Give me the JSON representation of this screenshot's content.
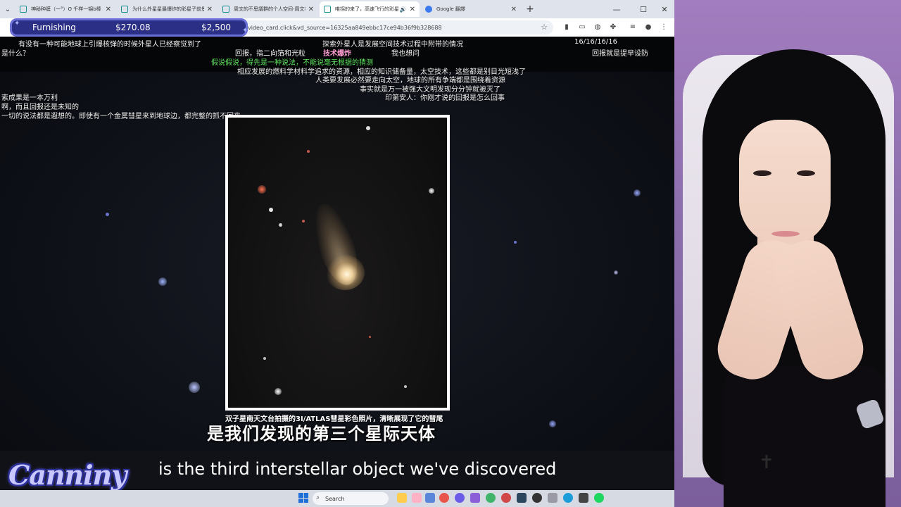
{
  "tabs": [
    {
      "label": "神秘种膜（一°）O 千样一锦b棒",
      "icon": "tab-page-icon",
      "active": false
    },
    {
      "label": "为什么外星星最爆炸的彩星子前景号",
      "icon": "tab-page-icon",
      "active": false
    },
    {
      "label": "周文的不思議群的个人空间-周文初",
      "icon": "tab-page-icon",
      "active": false
    },
    {
      "label": "唯拐的来了，高速飞行的彩星…",
      "icon": "tab-page-icon",
      "active": true
    },
    {
      "label": "Google 翻譯",
      "icon": "google-translate-icon",
      "active": false
    }
  ],
  "address": {
    "url": "video_card.click&vd_source=16325aa849ebbc17ce94b36f9b328688"
  },
  "furnishing": {
    "label": "Furnishing",
    "value": "$270.08",
    "target": "$2,500"
  },
  "danmaku": [
    {
      "text": "有没有一种可能地球上引爆核弹的时候外星人已经察觉到了",
      "color": "white"
    },
    {
      "text": "是什么？",
      "color": "white"
    },
    {
      "text": "探索外星人是发展空间技术过程中附带的情况",
      "color": "white"
    },
    {
      "text": "16/16/16/16",
      "color": "white"
    },
    {
      "text": "回报，指二向箔和光粒",
      "color": "white"
    },
    {
      "text": "技术爆炸",
      "color": "pink"
    },
    {
      "text": "我也想问",
      "color": "white"
    },
    {
      "text": "回报就是提早设防",
      "color": "white"
    },
    {
      "text": "假说假说，得先是一种说法，不能说毫无根据的猜测",
      "color": "green"
    },
    {
      "text": "相应发展的燃料学材料学追求的资源，相应的知识储备量，太空技术，这些都是别目光短浅了",
      "color": "white"
    },
    {
      "text": "人类要发展必然要走向太空，地球的所有争端都是围绕着资源",
      "color": "white"
    },
    {
      "text": "事实就是万一被强大文明发现分分钟就被灭了",
      "color": "white"
    },
    {
      "text": "印第安人：你刚才说的回报是怎么回事",
      "color": "white"
    },
    {
      "text": "索成果是一本万利",
      "color": "white"
    },
    {
      "text": "啊，而且回报还是未知的",
      "color": "white"
    },
    {
      "text": "一切的说法都是遐想的。即使有一个金属彗星来到地球边，都完整的抓不回来",
      "color": "white"
    }
  ],
  "video": {
    "photo_caption": "双子星南天文台拍摄的3I/ATLAS彗星彩色照片，清晰展现了它的彗尾",
    "cn_subtitle": "是我们发现的第三个星际天体",
    "en_subtitle": "is the third interstellar object we've discovered"
  },
  "logo": {
    "text": "Canniny"
  },
  "taskbar": {
    "search_placeholder": "Search"
  },
  "colors": {
    "tabstrip": "#dfe3ec",
    "furnish_bg": "#2c2f86",
    "danmaku_green": "#5ee65e",
    "danmaku_pink": "#ff9ed4"
  }
}
